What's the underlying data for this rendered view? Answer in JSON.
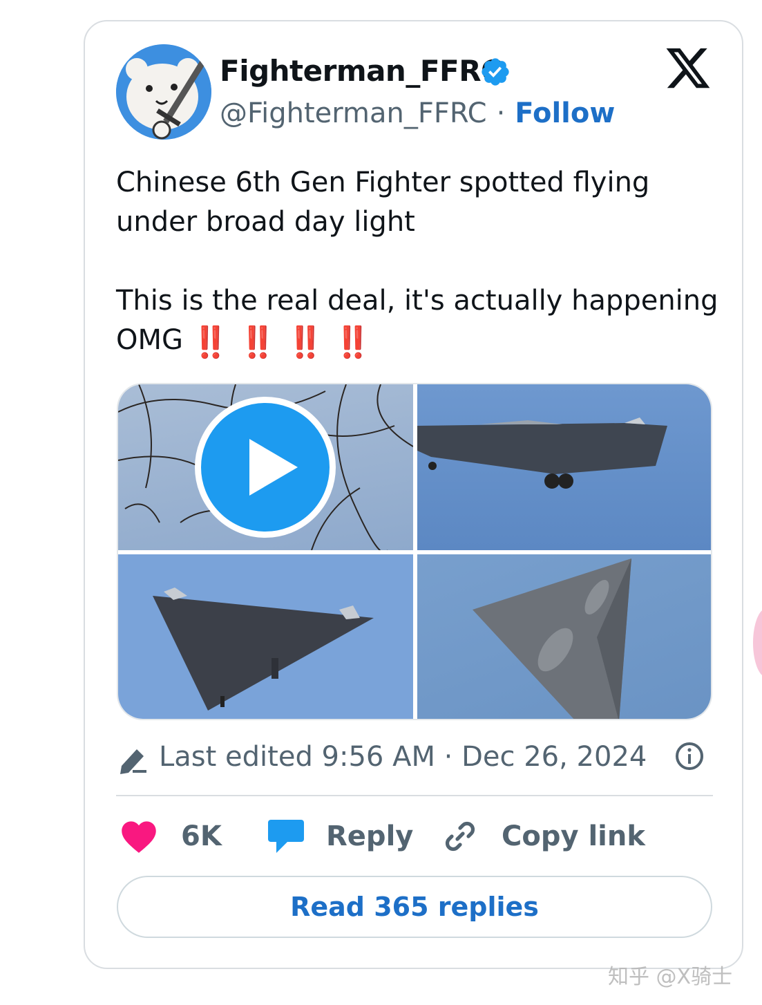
{
  "tweet": {
    "display_name": "Fighterman_FFRC",
    "handle": "@Fighterman_FFRC",
    "separator": "·",
    "follow_label": "Follow",
    "text": "Chinese 6th Gen Fighter spotted flying\nunder broad day light\n\nThis is the real deal, it's actually happening\nOMG",
    "emoji": [
      "‼️",
      "‼️",
      "‼️",
      "‼️"
    ],
    "edited": "Last edited 9:56 AM · Dec 26, 2024"
  },
  "actions": {
    "like_count": "6K",
    "reply_label": "Reply",
    "copy_label": "Copy link",
    "read_replies": "Read 365 replies"
  },
  "watermark": "知乎 @X骑士",
  "colors": {
    "accent": "#1d9bf0",
    "link": "#1d6fc7",
    "like": "#f91880",
    "muted": "#536471",
    "emoji_red": "#d11f3a"
  },
  "icons": [
    "verified-badge-icon",
    "x-logo-icon",
    "play-icon",
    "pencil-icon",
    "info-icon",
    "heart-icon",
    "reply-bubble-icon",
    "link-icon"
  ]
}
